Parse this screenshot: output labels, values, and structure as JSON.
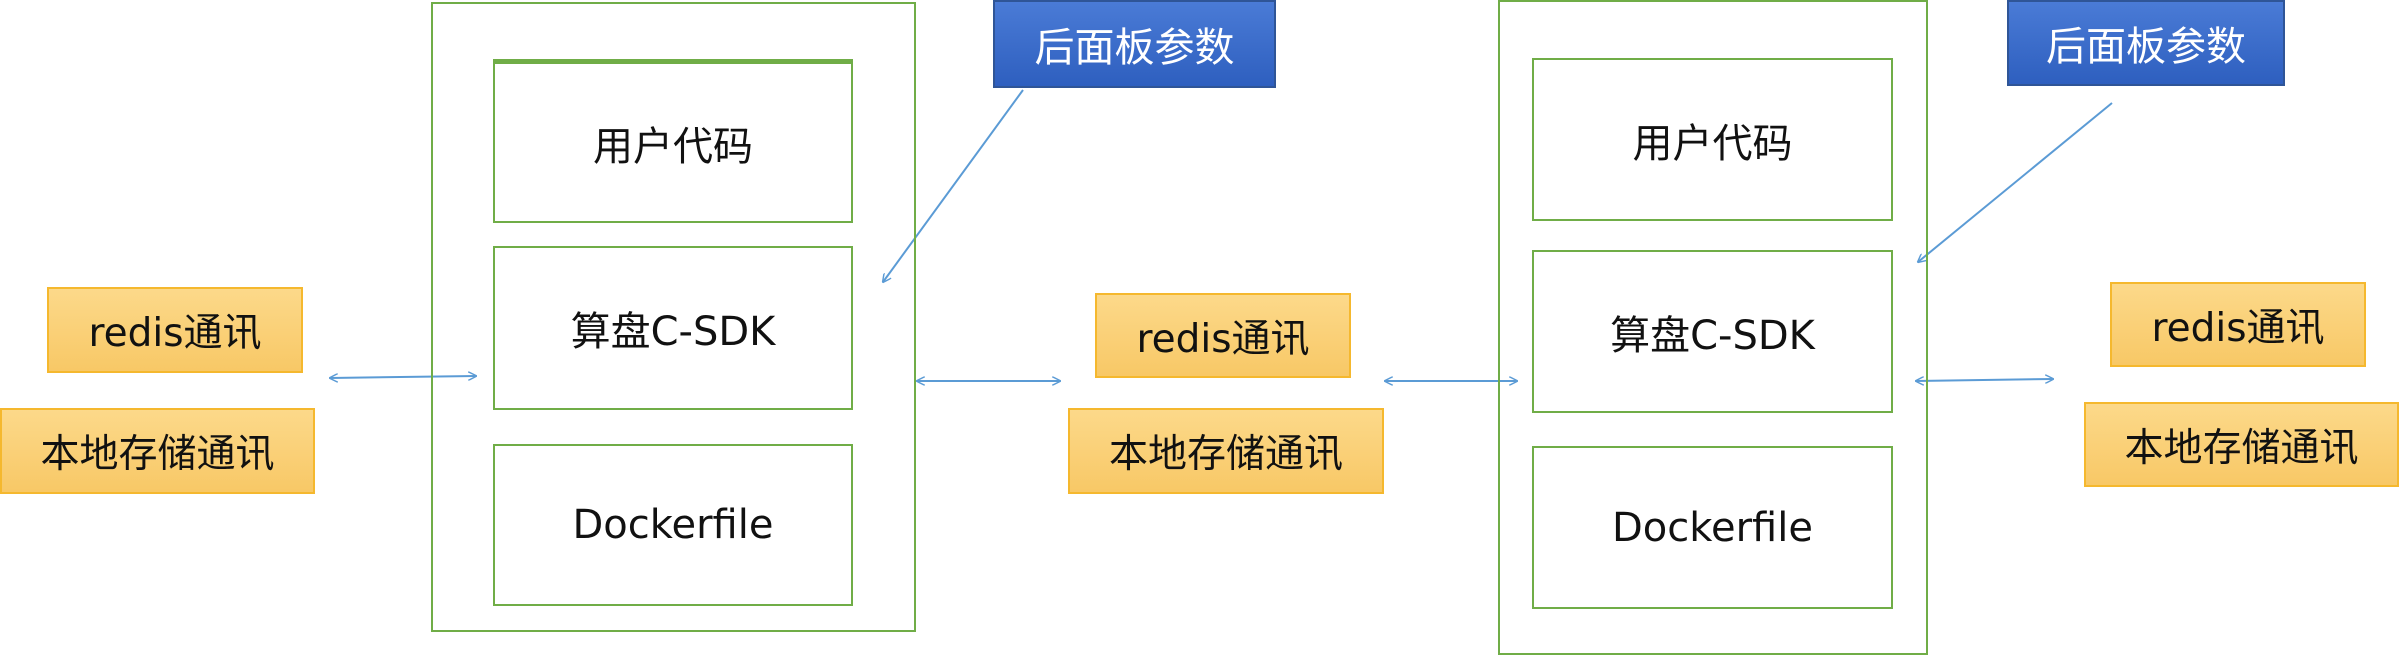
{
  "colors": {
    "container_border": "#70ad47",
    "comm_fill": "#fbd070",
    "comm_border": "#f5b82e",
    "param_fill": "#3b6dca",
    "arrow": "#5b9bd5"
  },
  "nodes": {
    "left_comm": {
      "redis": "redis通讯",
      "local_storage": "本地存储通讯"
    },
    "container_1": {
      "user_code": "用户代码",
      "sdk": "算盘C-SDK",
      "dockerfile": "Dockerfile"
    },
    "param_1": "后面板参数",
    "middle_comm": {
      "redis": "redis通讯",
      "local_storage": "本地存储通讯"
    },
    "container_2": {
      "user_code": "用户代码",
      "sdk": "算盘C-SDK",
      "dockerfile": "Dockerfile"
    },
    "param_2": "后面板参数",
    "right_comm": {
      "redis": "redis通讯",
      "local_storage": "本地存储通讯"
    }
  }
}
